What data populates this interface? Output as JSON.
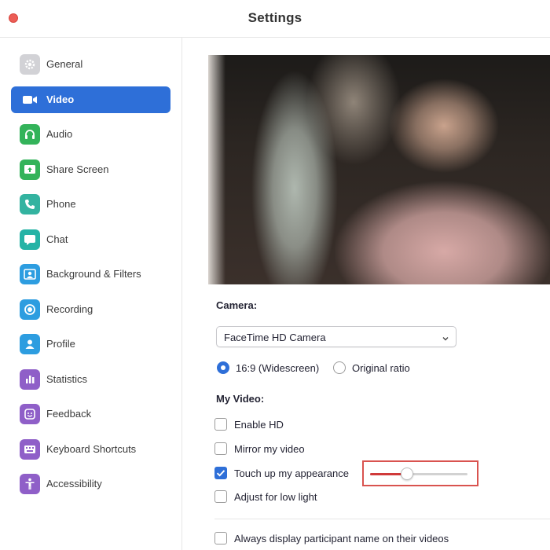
{
  "window": {
    "title": "Settings"
  },
  "sidebar": {
    "items": [
      {
        "label": "General",
        "icon": "gear-icon",
        "color": "#cfcfd3",
        "active": false
      },
      {
        "label": "Video",
        "icon": "video-camera-icon",
        "color": "#2e6fd8",
        "active": true
      },
      {
        "label": "Audio",
        "icon": "headphones-icon",
        "color": "#33b35a",
        "active": false
      },
      {
        "label": "Share Screen",
        "icon": "share-screen-icon",
        "color": "#33b35a",
        "active": false
      },
      {
        "label": "Phone",
        "icon": "phone-icon",
        "color": "#33b3a0",
        "active": false
      },
      {
        "label": "Chat",
        "icon": "chat-bubble-icon",
        "color": "#25b3a6",
        "active": false
      },
      {
        "label": "Background & Filters",
        "icon": "portrait-icon",
        "color": "#2d9de0",
        "active": false
      },
      {
        "label": "Recording",
        "icon": "record-icon",
        "color": "#2d9de0",
        "active": false
      },
      {
        "label": "Profile",
        "icon": "person-icon",
        "color": "#2d9de0",
        "active": false
      },
      {
        "label": "Statistics",
        "icon": "bar-chart-icon",
        "color": "#8f5fc8",
        "active": false
      },
      {
        "label": "Feedback",
        "icon": "smiley-icon",
        "color": "#8f5fc8",
        "active": false
      },
      {
        "label": "Keyboard Shortcuts",
        "icon": "keyboard-icon",
        "color": "#8f5fc8",
        "active": false
      },
      {
        "label": "Accessibility",
        "icon": "accessibility-icon",
        "color": "#8f5fc8",
        "active": false
      }
    ]
  },
  "video": {
    "camera_label": "Camera:",
    "camera_value": "FaceTime HD Camera",
    "ratio_options": [
      {
        "label": "16:9 (Widescreen)",
        "selected": true
      },
      {
        "label": "Original ratio",
        "selected": false
      }
    ],
    "my_video_label": "My Video:",
    "options": [
      {
        "label": "Enable HD",
        "checked": false
      },
      {
        "label": "Mirror my video",
        "checked": false
      },
      {
        "label": "Touch up my appearance",
        "checked": true
      },
      {
        "label": "Adjust for low light",
        "checked": false
      }
    ],
    "touch_up_level": 0.38,
    "always_display_label": "Always display participant name on their videos",
    "always_display_checked": false
  },
  "colors": {
    "accent": "#2e6fd8",
    "highlight": "#d9534f",
    "slider_fill": "#d03a3a"
  }
}
